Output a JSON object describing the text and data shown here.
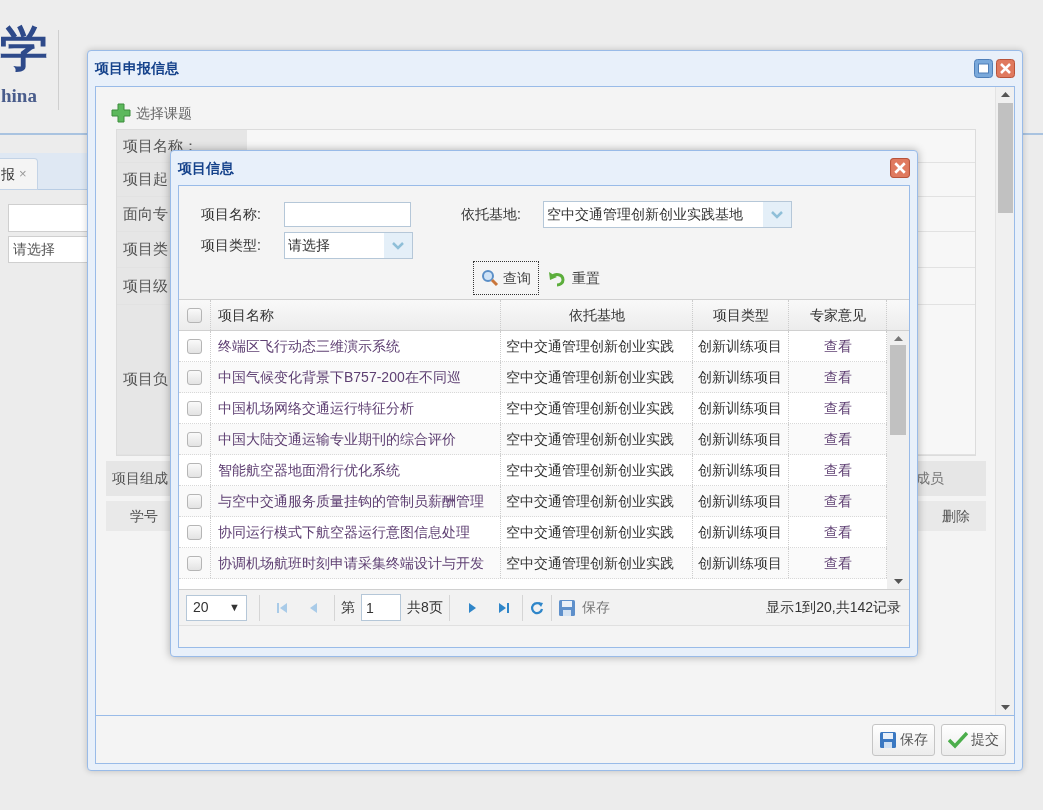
{
  "page": {
    "logo_char": "学",
    "logo_text": "hina",
    "tab": {
      "label": "报",
      "close": "×"
    },
    "select_value": "请选择"
  },
  "main_dialog": {
    "title": "项目申报信息",
    "select_topic": "选择课题",
    "fields": [
      {
        "label": "项目名称："
      },
      {
        "label": "项目起"
      },
      {
        "label": "面向专"
      },
      {
        "label": "项目类"
      },
      {
        "label": "项目级"
      },
      {
        "label": "项目负"
      }
    ],
    "members_label": "项目组成",
    "members_right": "成员",
    "member_columns": [
      "学号",
      "删除"
    ],
    "buttons": [
      "保存",
      "提交"
    ]
  },
  "project_dialog": {
    "title": "项目信息",
    "filters": {
      "name_label": "项目名称:",
      "base_label": "依托基地:",
      "base_value": "空中交通管理创新创业实践基地",
      "type_label": "项目类型:",
      "type_value": "请选择"
    },
    "buttons": [
      "查询",
      "重置"
    ],
    "all_checked": false,
    "columns": [
      "项目名称",
      "依托基地",
      "项目类型",
      "专家意见"
    ],
    "rows": [
      {
        "checked": false,
        "name": "终端区飞行动态三维演示系统",
        "base": "空中交通管理创新创业实践",
        "type": "创新训练项目",
        "opinion": "查看"
      },
      {
        "checked": false,
        "name": "中国气候变化背景下B757-200在不同巡",
        "base": "空中交通管理创新创业实践",
        "type": "创新训练项目",
        "opinion": "查看"
      },
      {
        "checked": false,
        "name": "中国机场网络交通运行特征分析",
        "base": "空中交通管理创新创业实践",
        "type": "创新训练项目",
        "opinion": "查看"
      },
      {
        "checked": false,
        "name": "中国大陆交通运输专业期刊的综合评价",
        "base": "空中交通管理创新创业实践",
        "type": "创新训练项目",
        "opinion": "查看"
      },
      {
        "checked": false,
        "name": "智能航空器地面滑行优化系统",
        "base": "空中交通管理创新创业实践",
        "type": "创新训练项目",
        "opinion": "查看"
      },
      {
        "checked": false,
        "name": "与空中交通服务质量挂钩的管制员薪酬管理",
        "base": "空中交通管理创新创业实践",
        "type": "创新训练项目",
        "opinion": "查看"
      },
      {
        "checked": false,
        "name": "协同运行模式下航空器运行意图信息处理",
        "base": "空中交通管理创新创业实践",
        "type": "创新训练项目",
        "opinion": "查看"
      },
      {
        "checked": false,
        "name": "协调机场航班时刻申请采集终端设计与开发",
        "base": "空中交通管理创新创业实践",
        "type": "创新训练项目",
        "opinion": "查看"
      }
    ],
    "pager": {
      "page_size": "20",
      "caret": "▼",
      "page_prefix": "第",
      "page": "1",
      "page_total": "共8页",
      "save": "保存",
      "summary": "显示1到20,共142记录"
    }
  }
}
